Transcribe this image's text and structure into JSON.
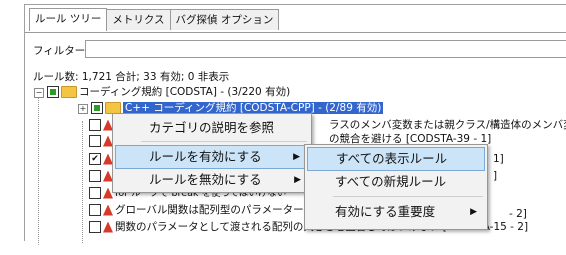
{
  "tabs": [
    "ルール ツリー",
    "メトリクス",
    "バグ探偵 オプション"
  ],
  "filter_label": "フィルター",
  "summary": "ルール数: 1,721 合計; 33 有効; 0 非表示",
  "tree": {
    "root": "コーディング規約 [CODSTA] - (3/220 有効)",
    "selected": "C++ コーディング規約 [CODSTA-CPP] - (2/89 有効)",
    "rows": [
      {
        "text": "ラスのメンバ変数または親クラス/構造体のメンバ変数"
      },
      {
        "text": "の競合を避ける [CODSTA-39 - 1]"
      },
      {
        "text": "1]"
      },
      {
        "text": "]"
      },
      {
        "text": "for ループで break を使ってはいけない"
      },
      {
        "text": "グローバル関数は配列型のパラメーターを"
      },
      {
        "text": "- 2]"
      },
      {
        "text": "関数のパラメータとして渡される配列の大きさを宣言してはいけない [CODSTA-15 - 2]"
      }
    ]
  },
  "context_menu": {
    "items": [
      "カテゴリの説明を参照",
      "ルールを有効にする",
      "ルールを無効にする"
    ]
  },
  "submenu": {
    "items": [
      "すべての表示ルール",
      "すべての新規ルール",
      "有効にする重要度"
    ]
  },
  "colors": {
    "selection": "#3366cc",
    "menu_highlight": "#cce4f7"
  }
}
